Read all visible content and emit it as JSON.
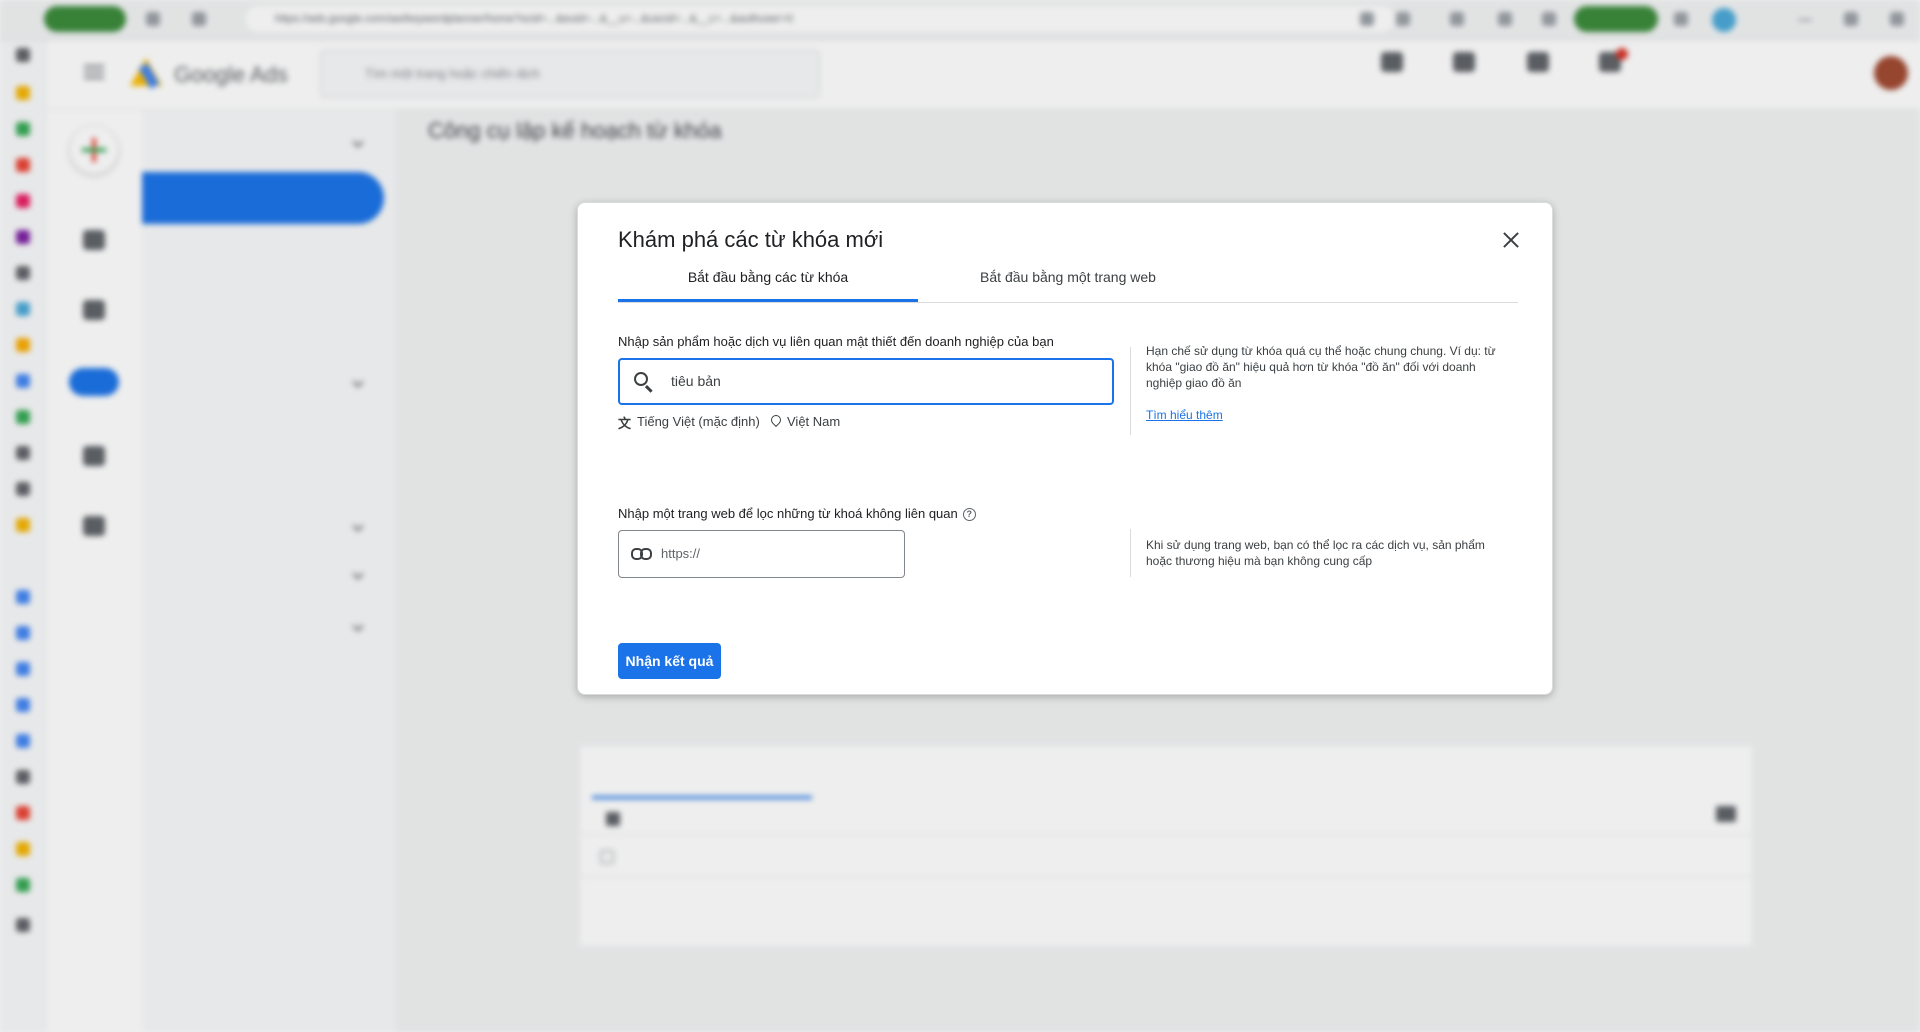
{
  "browser": {
    "url": "https://ads.google.com/aw/keywordplanner/home?ocid=...&euid=...&__u=...&uscid=...&__c=...&authuser=0"
  },
  "header": {
    "brand": "Google Ads",
    "search_placeholder": "Tìm một trang hoặc chiến dịch"
  },
  "side_nav": {
    "page_title": "Công cụ lập kế hoạch từ khóa"
  },
  "dialog": {
    "title": "Khám phá các từ khóa mới",
    "tabs": [
      {
        "label": "Bắt đầu bằng các từ khóa",
        "active": true
      },
      {
        "label": "Bắt đầu bằng một trang web",
        "active": false
      }
    ],
    "keywords_section": {
      "label": "Nhập sản phẩm hoặc dịch vụ liên quan mật thiết đến doanh nghiệp của bạn",
      "input_value": "tiêu bản",
      "language": "Tiếng Việt (mặc định)",
      "location": "Việt Nam",
      "help_text": "Hạn chế sử dụng từ khóa quá cụ thể hoặc chung chung. Ví dụ: từ khóa \"giao đồ ăn\" hiệu quả hơn từ khóa \"đồ ăn\" đối với doanh nghiệp giao đồ ăn",
      "learn_more": "Tìm hiểu thêm"
    },
    "website_section": {
      "label": "Nhập một trang web để lọc những từ khoá không liên quan",
      "placeholder": "https://",
      "help_text": "Khi sử dụng trang web, bạn có thể lọc ra các dịch vụ, sản phẩm hoặc thương hiệu mà bạn không cung cấp"
    },
    "submit_label": "Nhận kết quả"
  },
  "colors": {
    "accent": "#1a73e8",
    "text": "#202124",
    "divider": "#dadce0"
  },
  "icons": [
    "close-icon",
    "search-icon",
    "translate-icon",
    "location-pin-icon",
    "help-circle-icon",
    "link-icon"
  ]
}
